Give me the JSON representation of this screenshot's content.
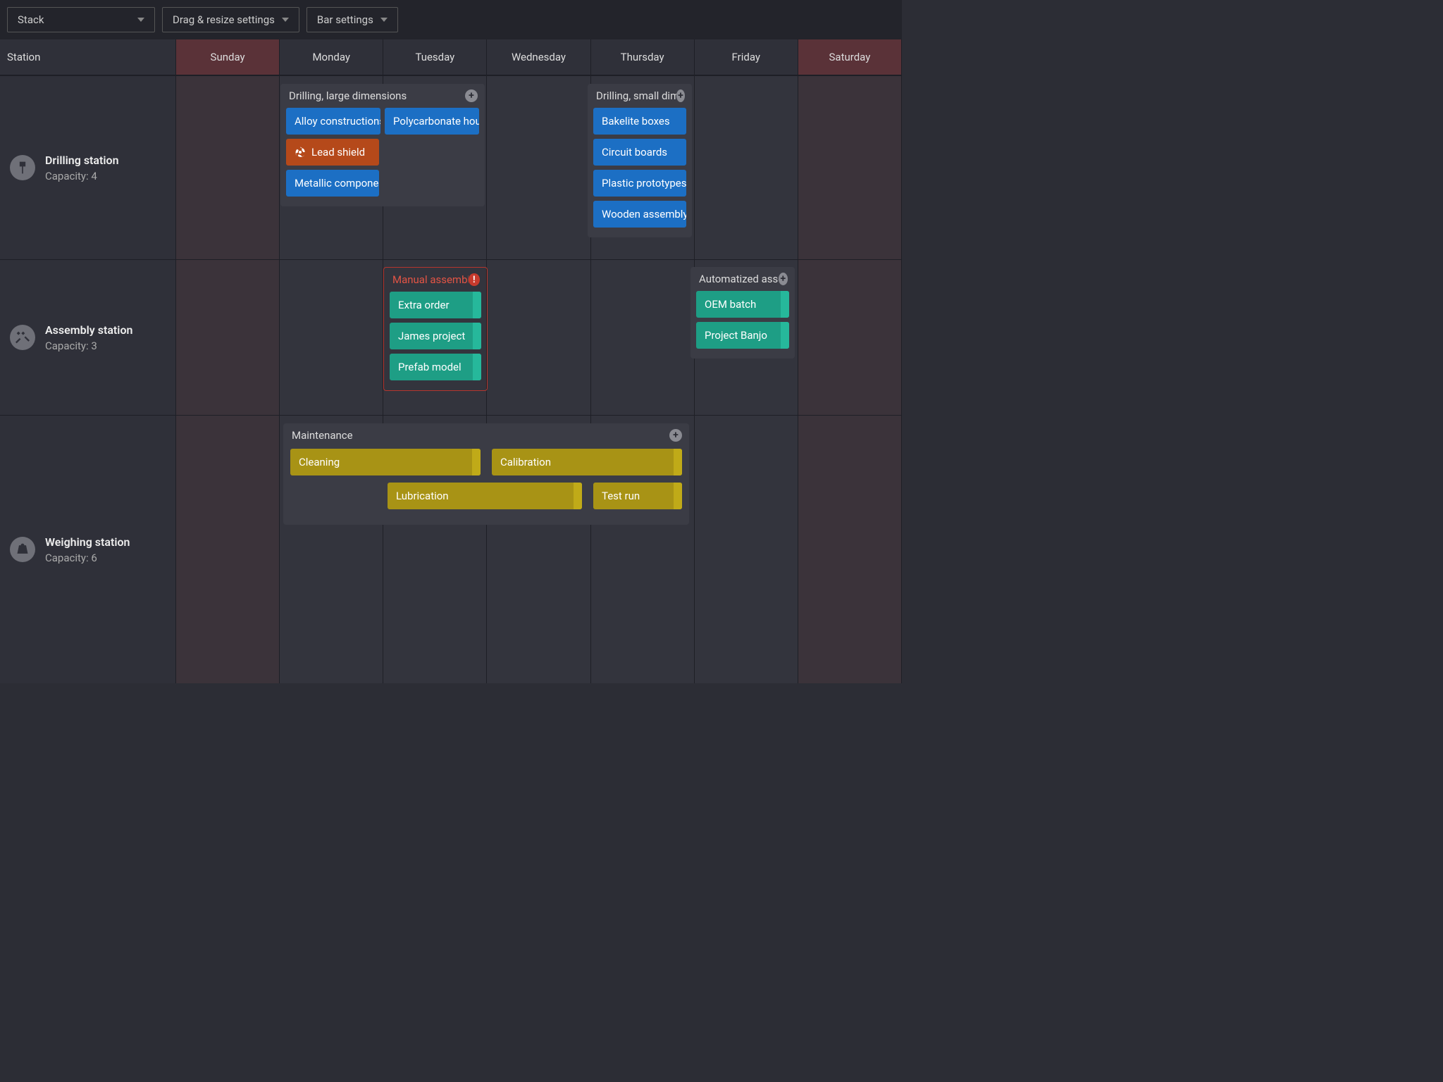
{
  "toolbar": {
    "stack_select": "Stack",
    "drag_resize": "Drag & resize settings",
    "bar_settings": "Bar settings"
  },
  "columns": {
    "station": "Station",
    "days": [
      "Sunday",
      "Monday",
      "Tuesday",
      "Wednesday",
      "Thursday",
      "Friday",
      "Saturday"
    ]
  },
  "stations": [
    {
      "name": "Drilling station",
      "capacity_label": "Capacity: 4"
    },
    {
      "name": "Assembly station",
      "capacity_label": "Capacity: 3"
    },
    {
      "name": "Weighing station",
      "capacity_label": "Capacity: 6"
    }
  ],
  "groups": {
    "drilling_large": {
      "title": "Drilling, large dimensions",
      "tasks_row1": [
        "Alloy constructions",
        "Polycarbonate housing"
      ],
      "task_hazard": "Lead shield",
      "task_last": "Metallic components"
    },
    "drilling_small": {
      "title": "Drilling, small dimensions",
      "tasks": [
        "Bakelite boxes",
        "Circuit boards",
        "Plastic prototypes",
        "Wooden assembly"
      ]
    },
    "manual_assembly": {
      "title": "Manual assembly",
      "tasks": [
        "Extra order",
        "James project",
        "Prefab model"
      ]
    },
    "automatized": {
      "title": "Automatized assembly",
      "tasks": [
        "OEM batch",
        "Project Banjo"
      ]
    },
    "maintenance": {
      "title": "Maintenance",
      "bars": {
        "cleaning": "Cleaning",
        "calibration": "Calibration",
        "lubrication": "Lubrication",
        "test_run": "Test run"
      }
    }
  }
}
